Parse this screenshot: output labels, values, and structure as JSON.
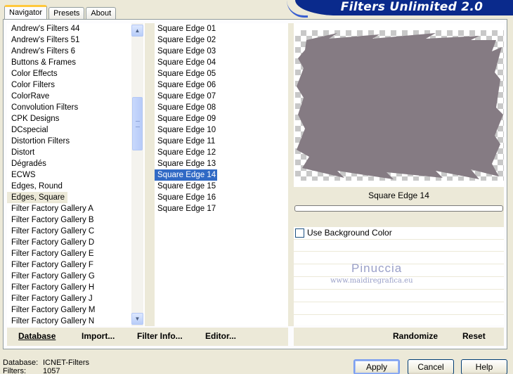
{
  "tabs": [
    {
      "label": "Navigator",
      "active": true
    },
    {
      "label": "Presets",
      "active": false
    },
    {
      "label": "About",
      "active": false
    }
  ],
  "banner_title": "Filters Unlimited 2.0",
  "categories": [
    "Andrew's Filters 44",
    "Andrew's Filters 51",
    "Andrew's Filters 6",
    "Buttons & Frames",
    "Color Effects",
    "Color Filters",
    "ColorRave",
    "Convolution Filters",
    "CPK Designs",
    "DCspecial",
    "Distortion Filters",
    "Distort",
    "Dégradés",
    "ECWS",
    "Edges, Round",
    "Edges, Square",
    "Filter Factory Gallery A",
    "Filter Factory Gallery B",
    "Filter Factory Gallery C",
    "Filter Factory Gallery D",
    "Filter Factory Gallery E",
    "Filter Factory Gallery F",
    "Filter Factory Gallery G",
    "Filter Factory Gallery H",
    "Filter Factory Gallery J",
    "Filter Factory Gallery M",
    "Filter Factory Gallery N"
  ],
  "selected_category": "Edges, Square",
  "filters": [
    "Square Edge 01",
    "Square Edge 02",
    "Square Edge 03",
    "Square Edge 04",
    "Square Edge 05",
    "Square Edge 06",
    "Square Edge 07",
    "Square Edge 08",
    "Square Edge 09",
    "Square Edge 10",
    "Square Edge 11",
    "Square Edge 12",
    "Square Edge 13",
    "Square Edge 14",
    "Square Edge 15",
    "Square Edge 16",
    "Square Edge 17"
  ],
  "selected_filter": "Square Edge 14",
  "preview": {
    "filter_name": "Square Edge 14",
    "fill_color": "#857b83",
    "progress": 0
  },
  "use_background_color": {
    "label": "Use Background Color",
    "checked": false
  },
  "watermark": {
    "name": "Pinuccia",
    "site": "www.maidiregrafica.eu"
  },
  "actions_left": [
    "Database",
    "Import...",
    "Filter Info...",
    "Editor..."
  ],
  "actions_right": [
    "Randomize",
    "Reset"
  ],
  "status": {
    "database_label": "Database:",
    "database_value": "ICNET-Filters",
    "filters_label": "Filters:",
    "filters_value": "1057"
  },
  "buttons": {
    "apply": "Apply",
    "cancel": "Cancel",
    "help": "Help"
  },
  "colors": {
    "selection": "#316ac5",
    "banner": "#0a2a8c"
  }
}
